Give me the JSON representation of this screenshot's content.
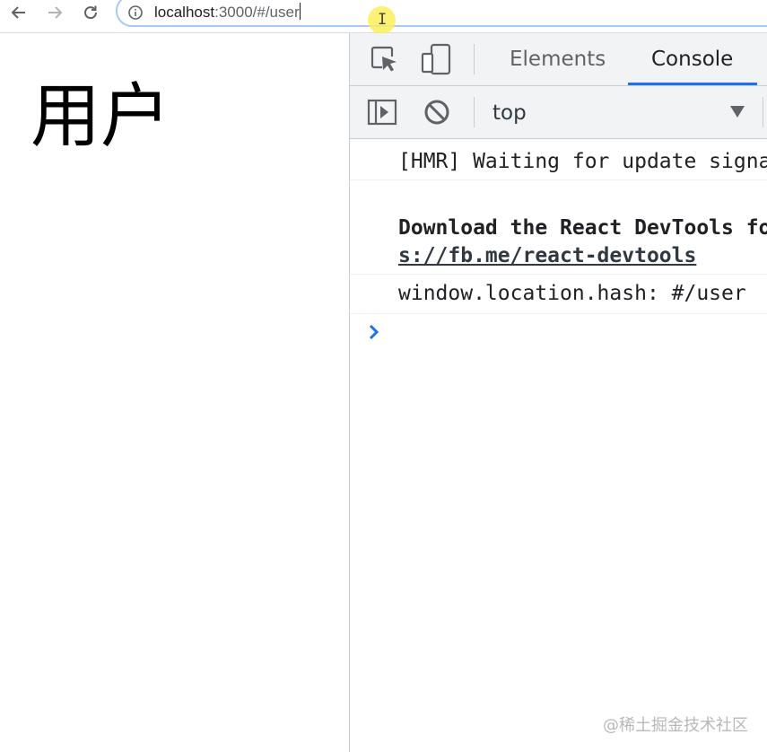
{
  "browser": {
    "address_host": "localhost",
    "address_path": ":3000/#/user",
    "icons": {
      "back": "arrow-left-icon",
      "forward": "arrow-right-icon",
      "reload": "reload-icon",
      "site_info": "info-icon"
    }
  },
  "page": {
    "title": "用户"
  },
  "devtools": {
    "tabs": [
      {
        "label": "Elements",
        "active": false
      },
      {
        "label": "Console",
        "active": true
      }
    ],
    "context": "top",
    "accent_color": "#1a73e8",
    "messages": [
      {
        "text": "[HMR] Waiting for update signal from WDS..."
      },
      {
        "text": "Download the React DevTools for a better development experience: http",
        "link": "s://fb.me/react-devtools"
      },
      {
        "text": "window.location.hash: #/user"
      }
    ]
  },
  "watermark": "@稀土掘金技术社区"
}
